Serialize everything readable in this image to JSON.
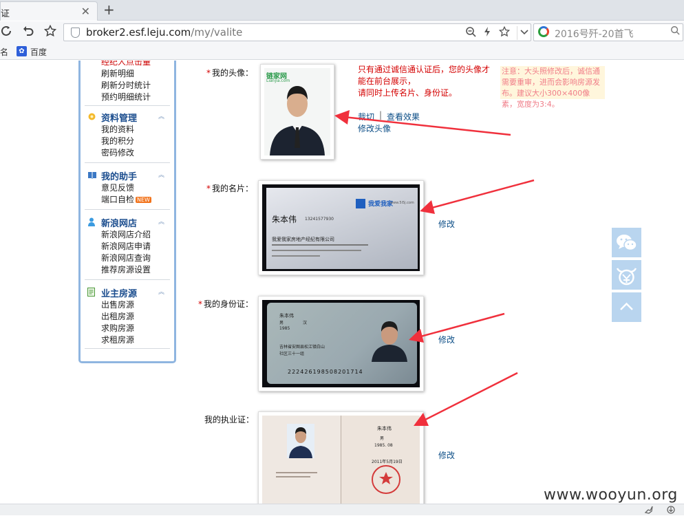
{
  "browser": {
    "tab_title": "证",
    "tab_close": "✕",
    "new_tab": "+",
    "url_host": "broker2.esf.leju.com",
    "url_path": "/my/valite",
    "search_text": "2016号歼-20首飞",
    "bookmarks": [
      "名",
      "百度"
    ]
  },
  "sidebar": {
    "top_items": [
      "经纪人点击量",
      "刷新明细",
      "刷新分时统计",
      "预约明细统计"
    ],
    "groups": [
      {
        "title": "资料管理",
        "items": [
          "我的资料",
          "我的积分",
          "密码修改"
        ]
      },
      {
        "title": "我的助手",
        "items": [
          "意见反馈",
          "端口自检"
        ],
        "badge": "NEW"
      },
      {
        "title": "新浪网店",
        "items": [
          "新浪网店介绍",
          "新浪网店申请",
          "新浪网店查询",
          "推荐房源设置"
        ]
      },
      {
        "title": "业主房源",
        "items": [
          "出售房源",
          "出租房源",
          "求购房源",
          "求租房源"
        ]
      }
    ]
  },
  "form": {
    "required_mark": "*",
    "avatar_label": "我的头像：",
    "card_label": "我的名片：",
    "idcard_label": "我的身份证：",
    "license_label": "我的执业证：",
    "avatar_notice_1": "只有通过诚信通认证后，您的头像才",
    "avatar_notice_2": "能在前台展示，",
    "avatar_notice_3": "请同时上传名片、身份证。",
    "crop_link": "裁切",
    "separator": "|",
    "preview_link": "查看效果",
    "edit_avatar_link": "修改头像",
    "edit_link": "修改",
    "note": "注意：大头照修改后，诚信通需要重审，进而会影响房源发布。建议大小300×400像素，宽度为3:4。"
  },
  "photos": {
    "avatar_brand": "链家网",
    "avatar_brand_sub": "Lianjia.com",
    "card_name": "朱本伟",
    "card_phone": "13241577930",
    "card_brand": "我爱我家",
    "card_brand_sub": "www.5i5j.com",
    "card_company": "我爱我家房地产经纪有限公司",
    "id_name": "朱本伟",
    "id_gender": "男",
    "id_ethnic": "汉",
    "id_birth": "1985",
    "id_address": "吉林省安图县松江镇白山",
    "id_address2": "社区三十一组",
    "id_number": "222426198508201714",
    "license_name": "朱本伟",
    "license_gender": "男",
    "license_birth": "1985. 08",
    "license_date": "2011年5月19日"
  },
  "watermark": "www.wooyun.org",
  "colors": {
    "link": "#0b4d86",
    "red": "#d40000",
    "sidebar_border": "#8fb5e0",
    "arrow": "#f0303c",
    "float_btn": "#b9d5ef"
  }
}
